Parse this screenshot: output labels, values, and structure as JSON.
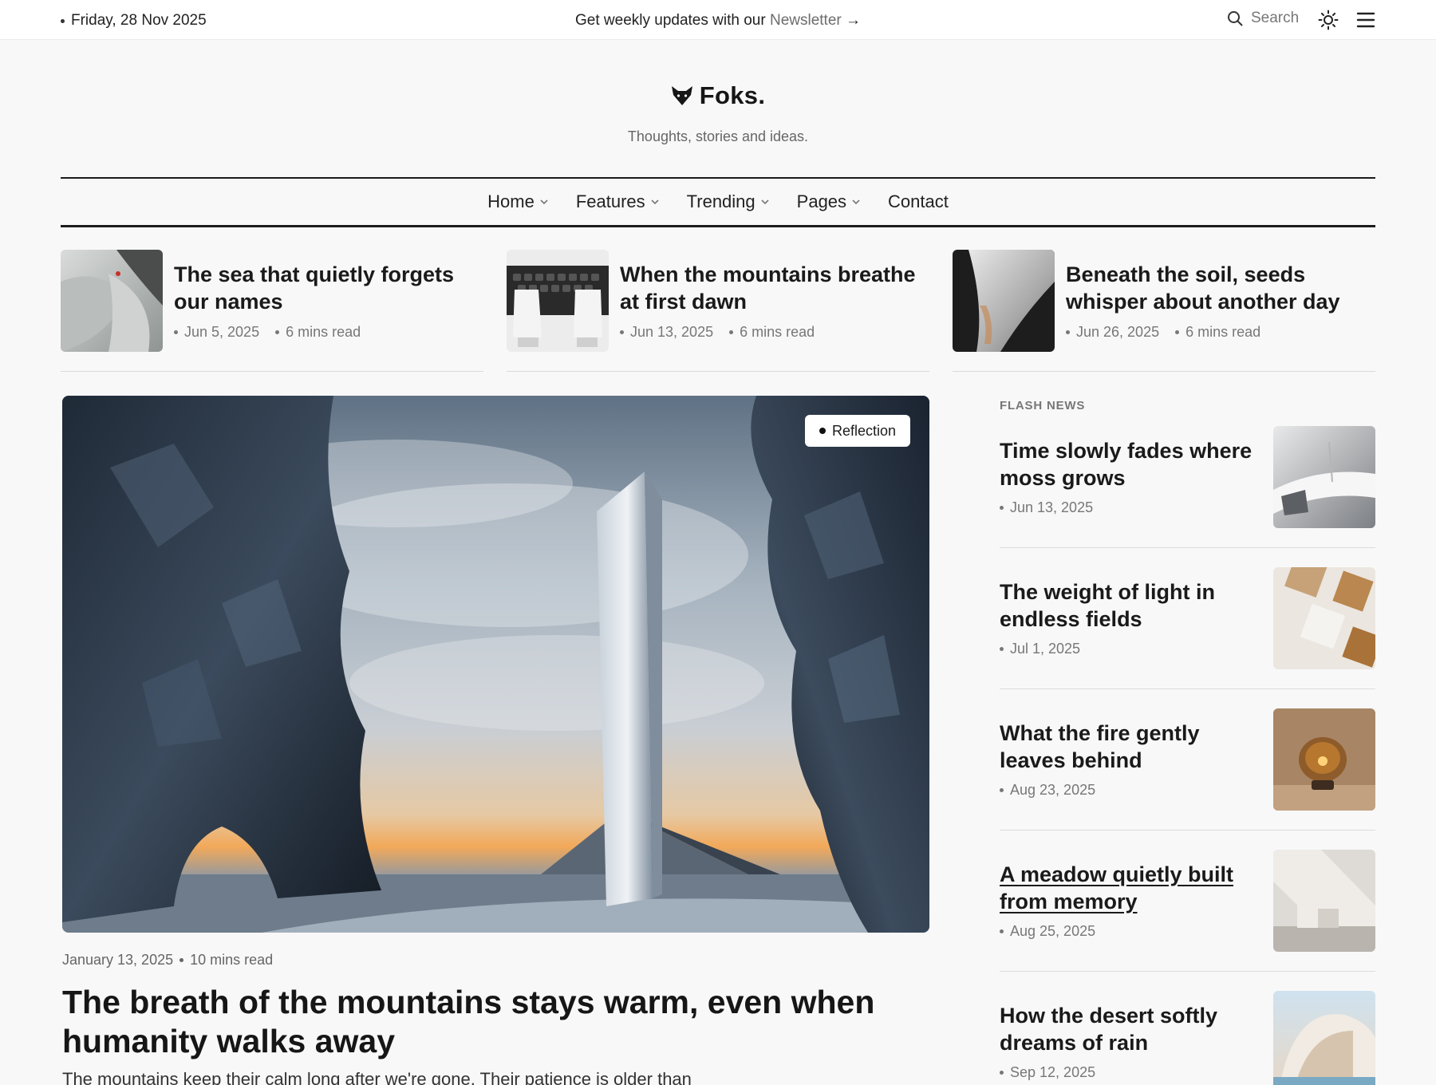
{
  "topbar": {
    "date": "Friday, 28 Nov 2025",
    "promo_text": "Get weekly updates with our",
    "promo_link": "Newsletter",
    "promo_arrow": "→",
    "search_label": "Search"
  },
  "brand": {
    "name": "Foks.",
    "tagline": "Thoughts, stories and ideas."
  },
  "nav": {
    "items": [
      {
        "label": "Home",
        "has_dropdown": true
      },
      {
        "label": "Features",
        "has_dropdown": true
      },
      {
        "label": "Trending",
        "has_dropdown": true
      },
      {
        "label": "Pages",
        "has_dropdown": true
      },
      {
        "label": "Contact",
        "has_dropdown": false
      }
    ]
  },
  "top_stories": [
    {
      "title": "The sea that quietly forgets our names",
      "date": "Jun 5, 2025",
      "read_time": "6 mins read"
    },
    {
      "title": "When the mountains breathe at first dawn",
      "date": "Jun 13, 2025",
      "read_time": "6 mins read"
    },
    {
      "title": "Beneath the soil, seeds whisper about another day",
      "date": "Jun 26, 2025",
      "read_time": "6 mins read"
    }
  ],
  "hero": {
    "badge": "Reflection",
    "date": "January 13, 2025",
    "read_time": "10 mins read",
    "title": "The breath of the mountains stays warm, even when humanity walks away",
    "excerpt": "The mountains keep their calm long after we're gone. Their patience is older than"
  },
  "flash_news": {
    "label": "FLASH NEWS",
    "items": [
      {
        "title": "Time slowly fades where moss grows",
        "date": "Jun 13, 2025"
      },
      {
        "title": "The weight of light in endless fields",
        "date": "Jul 1, 2025"
      },
      {
        "title": "What the fire gently leaves behind",
        "date": "Aug 23, 2025"
      },
      {
        "title": "A meadow quietly built from memory",
        "date": "Aug 25, 2025"
      },
      {
        "title": "How the desert softly dreams of rain",
        "date": "Sep 12, 2025"
      }
    ]
  },
  "colors": {
    "background": "#f8f8f8",
    "text": "#1c1c1c",
    "muted": "#777777",
    "rule": "#1b1b1b"
  }
}
